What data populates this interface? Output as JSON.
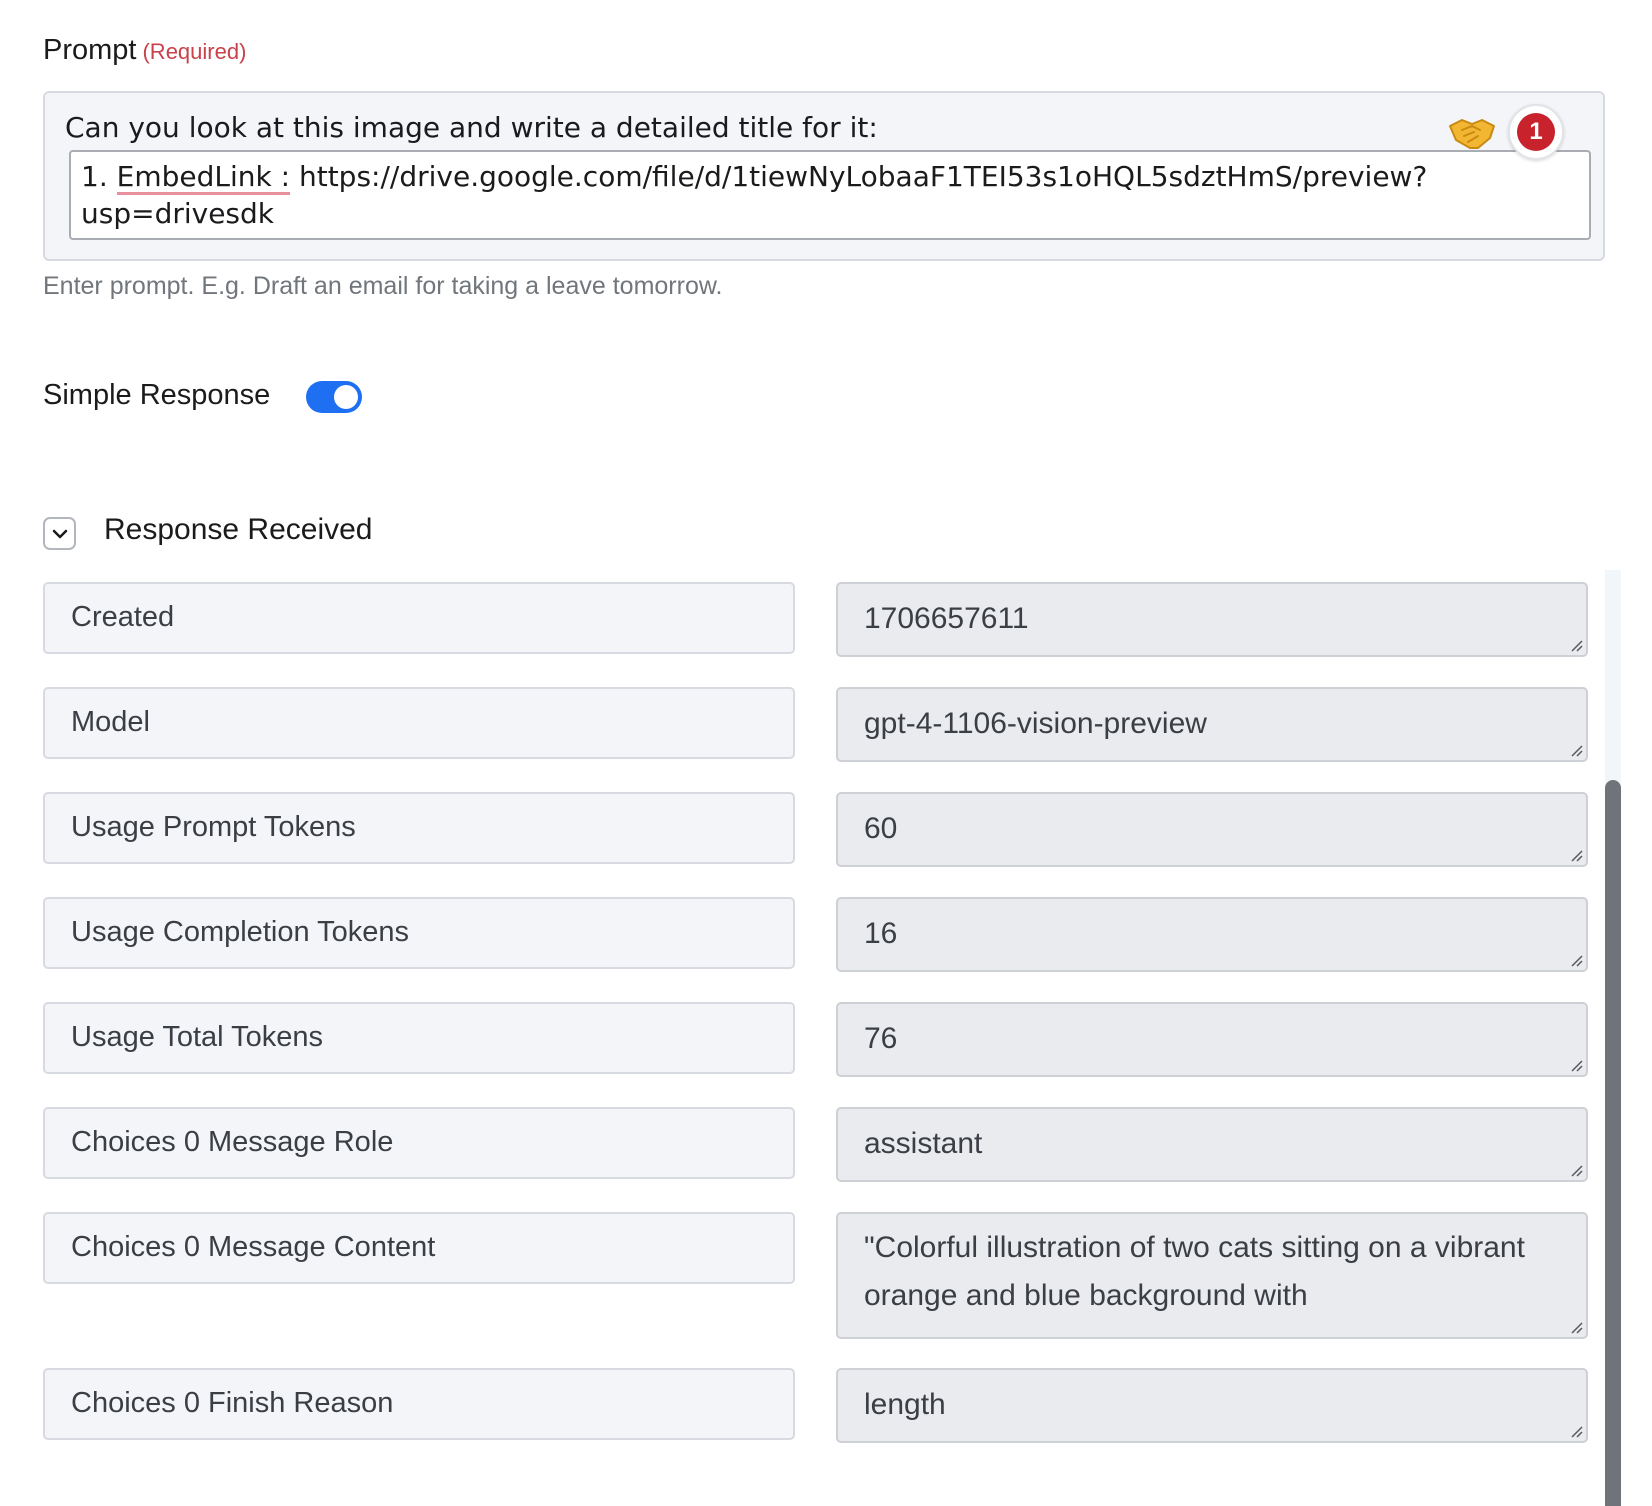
{
  "prompt": {
    "label": "Prompt",
    "required": "(Required)",
    "text": "Can you look at this image and write a detailed title for it:",
    "embed_number": "1.",
    "embed_tag": "EmbedLink",
    "embed_sep": ":",
    "embed_url_line1": "https://drive.google.com/file/d/1tiewNyLobaaF1TEI53s1oHQL5sdztHmS/preview?",
    "embed_url_line2": "usp=drivesdk",
    "badge_count": "1",
    "hint": "Enter prompt. E.g. Draft an email for taking a leave tomorrow."
  },
  "simple_response": {
    "label": "Simple Response",
    "enabled": true
  },
  "response": {
    "title": "Response Received",
    "rows": [
      {
        "key": "Created",
        "value": "1706657611"
      },
      {
        "key": "Model",
        "value": "gpt-4-1106-vision-preview"
      },
      {
        "key": "Usage Prompt Tokens",
        "value": "60"
      },
      {
        "key": "Usage Completion Tokens",
        "value": "16"
      },
      {
        "key": "Usage Total Tokens",
        "value": "76"
      },
      {
        "key": "Choices 0 Message Role",
        "value": "assistant"
      },
      {
        "key": "Choices 0 Message Content",
        "value": "\"Colorful illustration of two cats sitting on a vibrant orange and blue background with"
      },
      {
        "key": "Choices 0 Finish Reason",
        "value": "length"
      }
    ]
  },
  "colors": {
    "accent": "#1f6ff3",
    "required": "#c9414b",
    "badge": "#c8232c"
  },
  "icons": {
    "collapse": "chevron-down-icon",
    "extension": "handshake-icon",
    "resize": "resize-grip-icon"
  }
}
